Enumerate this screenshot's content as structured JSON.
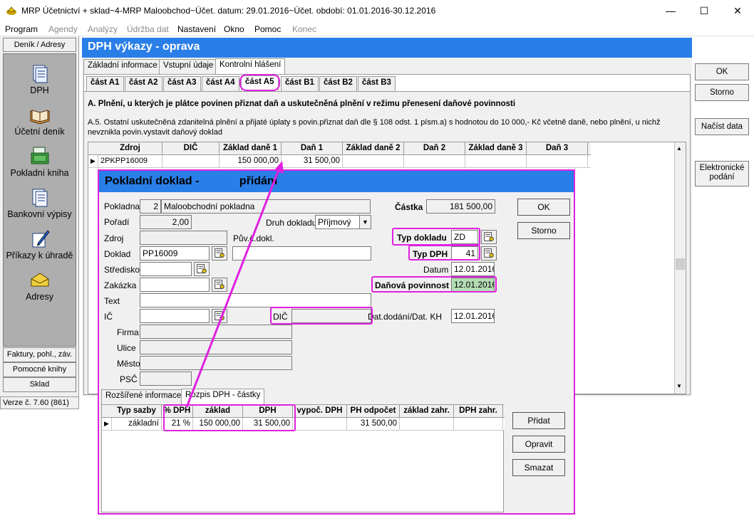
{
  "window": {
    "title": "MRP Účetnictví + sklad~4-MRP Maloobchod~Účet. datum: 29.01.2016~Účet. období: 01.01.2016-30.12.2016",
    "minimize": "—",
    "maximize": "☐",
    "close": "✕"
  },
  "menu": [
    {
      "label": "Program",
      "disabled": false
    },
    {
      "label": "Agendy",
      "disabled": true
    },
    {
      "label": "Analýzy",
      "disabled": true
    },
    {
      "label": "Údržba dat",
      "disabled": true
    },
    {
      "label": "Nastavení",
      "disabled": false
    },
    {
      "label": "Okno",
      "disabled": false
    },
    {
      "label": "Pomoc",
      "disabled": false
    },
    {
      "label": "Konec",
      "disabled": true
    }
  ],
  "sidebar": {
    "header": "Deník / Adresy",
    "items": [
      {
        "label": "DPH",
        "icon": "document-icon"
      },
      {
        "label": "Účetní deník",
        "icon": "book-icon"
      },
      {
        "label": "Pokladní kniha",
        "icon": "cash-register-icon"
      },
      {
        "label": "Bankovní výpisy",
        "icon": "bank-statement-icon"
      },
      {
        "label": "Příkazy k úhradě",
        "icon": "pen-icon"
      },
      {
        "label": "Adresy",
        "icon": "envelope-icon"
      }
    ],
    "footer": [
      "Faktury, pohl., záv.",
      "Pomocné knihy",
      "Sklad"
    ]
  },
  "status": {
    "version": "Verze č. 7.60 (861)"
  },
  "main": {
    "title": "DPH výkazy - oprava",
    "tabs": [
      "Základní informace",
      "Vstupní údaje",
      "Kontrolní hlášení"
    ],
    "subtabs": [
      "část A1",
      "část A2",
      "část A3",
      "část A4",
      "část A5",
      "část B1",
      "část B2",
      "část B3"
    ],
    "section_title": "A. Plnění, u kterých je plátce povinen přiznat daň a uskutečněná plnění v režimu přenesení daňové povinnosti",
    "section_desc": "A.5. Ostatní uskutečněná zdanitelná plnění a přijaté úplaty s povin.přiznat daň dle § 108 odst. 1 písm.a) s hodnotou do 10 000,- Kč včetně daně, nebo plnění, u nichž nevznikla povin.vystavit daňový doklad",
    "grid_headers": [
      "Zdroj",
      "DIČ",
      "Základ daně 1",
      "Daň 1",
      "Základ daně 2",
      "Daň 2",
      "Základ daně 3",
      "Daň 3"
    ],
    "grid_row": [
      "2PKPP16009",
      "",
      "150 000,00",
      "31 500,00",
      "",
      "",
      "",
      ""
    ],
    "buttons": {
      "ok": "OK",
      "storno": "Storno",
      "nacist": "Načíst data",
      "elektronicke": "Elektronické podání"
    }
  },
  "dialog": {
    "title": "Pokladní doklad  -",
    "mode": "přidání",
    "labels": {
      "pokladna": "Pokladna",
      "poradi": "Pořadí",
      "zdroj": "Zdroj",
      "doklad": "Doklad",
      "stredisko": "Středisko",
      "zakazka": "Zakázka",
      "text": "Text",
      "ic": "IČ",
      "firma": "Firma",
      "ulice": "Ulice",
      "mesto": "Město",
      "psc": "PSČ",
      "druh_dokladu": "Druh dokladu",
      "puv_dokl": "Pův.č.dokl.",
      "dic": "DIČ",
      "castka": "Částka",
      "typ_dokladu": "Typ dokladu",
      "typ_dph": "Typ DPH",
      "datum": "Datum",
      "danova_povinnost": "Daňová povinnost",
      "dat_dodani": "Dat.dodání/Dat. KH"
    },
    "values": {
      "pokladna_num": "2",
      "pokladna_name": "Maloobchodní pokladna",
      "poradi": "2,00",
      "druh_dokladu": "Příjmový",
      "doklad": "PP16009",
      "castka": "181 500,00",
      "typ_dokladu": "ZD",
      "typ_dph": "41",
      "datum": "12.01.2016",
      "danova_povinnost": "12.01.2016",
      "dat_dodani": "12.01.2016"
    },
    "buttons": {
      "ok": "OK",
      "storno": "Storno",
      "pridat": "Přidat",
      "opravit": "Opravit",
      "smazat": "Smazat"
    },
    "tabs": [
      "Rozšířené informace",
      "Rozpis DPH - částky"
    ],
    "vat_headers": [
      "Typ sazby",
      "% DPH",
      "základ",
      "DPH",
      "vypoč. DPH",
      "PH odpočet",
      "základ zahr.",
      "DPH zahr."
    ],
    "vat_row": [
      "základní",
      "21 %",
      "150 000,00",
      "31 500,00",
      "",
      "31 500,00",
      "",
      ""
    ]
  }
}
